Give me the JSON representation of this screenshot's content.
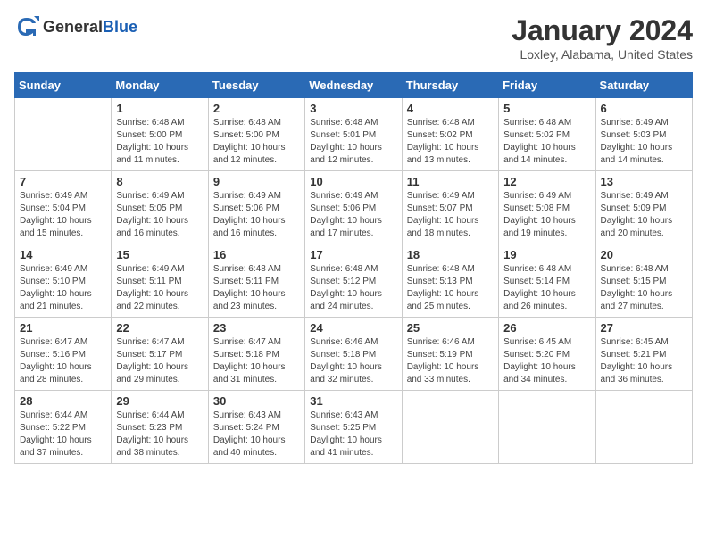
{
  "header": {
    "logo_general": "General",
    "logo_blue": "Blue",
    "month_year": "January 2024",
    "location": "Loxley, Alabama, United States"
  },
  "weekdays": [
    "Sunday",
    "Monday",
    "Tuesday",
    "Wednesday",
    "Thursday",
    "Friday",
    "Saturday"
  ],
  "weeks": [
    [
      {
        "day": "",
        "info": ""
      },
      {
        "day": "1",
        "info": "Sunrise: 6:48 AM\nSunset: 5:00 PM\nDaylight: 10 hours and 11 minutes."
      },
      {
        "day": "2",
        "info": "Sunrise: 6:48 AM\nSunset: 5:00 PM\nDaylight: 10 hours and 12 minutes."
      },
      {
        "day": "3",
        "info": "Sunrise: 6:48 AM\nSunset: 5:01 PM\nDaylight: 10 hours and 12 minutes."
      },
      {
        "day": "4",
        "info": "Sunrise: 6:48 AM\nSunset: 5:02 PM\nDaylight: 10 hours and 13 minutes."
      },
      {
        "day": "5",
        "info": "Sunrise: 6:48 AM\nSunset: 5:02 PM\nDaylight: 10 hours and 14 minutes."
      },
      {
        "day": "6",
        "info": "Sunrise: 6:49 AM\nSunset: 5:03 PM\nDaylight: 10 hours and 14 minutes."
      }
    ],
    [
      {
        "day": "7",
        "info": "Sunrise: 6:49 AM\nSunset: 5:04 PM\nDaylight: 10 hours and 15 minutes."
      },
      {
        "day": "8",
        "info": "Sunrise: 6:49 AM\nSunset: 5:05 PM\nDaylight: 10 hours and 16 minutes."
      },
      {
        "day": "9",
        "info": "Sunrise: 6:49 AM\nSunset: 5:06 PM\nDaylight: 10 hours and 16 minutes."
      },
      {
        "day": "10",
        "info": "Sunrise: 6:49 AM\nSunset: 5:06 PM\nDaylight: 10 hours and 17 minutes."
      },
      {
        "day": "11",
        "info": "Sunrise: 6:49 AM\nSunset: 5:07 PM\nDaylight: 10 hours and 18 minutes."
      },
      {
        "day": "12",
        "info": "Sunrise: 6:49 AM\nSunset: 5:08 PM\nDaylight: 10 hours and 19 minutes."
      },
      {
        "day": "13",
        "info": "Sunrise: 6:49 AM\nSunset: 5:09 PM\nDaylight: 10 hours and 20 minutes."
      }
    ],
    [
      {
        "day": "14",
        "info": "Sunrise: 6:49 AM\nSunset: 5:10 PM\nDaylight: 10 hours and 21 minutes."
      },
      {
        "day": "15",
        "info": "Sunrise: 6:49 AM\nSunset: 5:11 PM\nDaylight: 10 hours and 22 minutes."
      },
      {
        "day": "16",
        "info": "Sunrise: 6:48 AM\nSunset: 5:11 PM\nDaylight: 10 hours and 23 minutes."
      },
      {
        "day": "17",
        "info": "Sunrise: 6:48 AM\nSunset: 5:12 PM\nDaylight: 10 hours and 24 minutes."
      },
      {
        "day": "18",
        "info": "Sunrise: 6:48 AM\nSunset: 5:13 PM\nDaylight: 10 hours and 25 minutes."
      },
      {
        "day": "19",
        "info": "Sunrise: 6:48 AM\nSunset: 5:14 PM\nDaylight: 10 hours and 26 minutes."
      },
      {
        "day": "20",
        "info": "Sunrise: 6:48 AM\nSunset: 5:15 PM\nDaylight: 10 hours and 27 minutes."
      }
    ],
    [
      {
        "day": "21",
        "info": "Sunrise: 6:47 AM\nSunset: 5:16 PM\nDaylight: 10 hours and 28 minutes."
      },
      {
        "day": "22",
        "info": "Sunrise: 6:47 AM\nSunset: 5:17 PM\nDaylight: 10 hours and 29 minutes."
      },
      {
        "day": "23",
        "info": "Sunrise: 6:47 AM\nSunset: 5:18 PM\nDaylight: 10 hours and 31 minutes."
      },
      {
        "day": "24",
        "info": "Sunrise: 6:46 AM\nSunset: 5:18 PM\nDaylight: 10 hours and 32 minutes."
      },
      {
        "day": "25",
        "info": "Sunrise: 6:46 AM\nSunset: 5:19 PM\nDaylight: 10 hours and 33 minutes."
      },
      {
        "day": "26",
        "info": "Sunrise: 6:45 AM\nSunset: 5:20 PM\nDaylight: 10 hours and 34 minutes."
      },
      {
        "day": "27",
        "info": "Sunrise: 6:45 AM\nSunset: 5:21 PM\nDaylight: 10 hours and 36 minutes."
      }
    ],
    [
      {
        "day": "28",
        "info": "Sunrise: 6:44 AM\nSunset: 5:22 PM\nDaylight: 10 hours and 37 minutes."
      },
      {
        "day": "29",
        "info": "Sunrise: 6:44 AM\nSunset: 5:23 PM\nDaylight: 10 hours and 38 minutes."
      },
      {
        "day": "30",
        "info": "Sunrise: 6:43 AM\nSunset: 5:24 PM\nDaylight: 10 hours and 40 minutes."
      },
      {
        "day": "31",
        "info": "Sunrise: 6:43 AM\nSunset: 5:25 PM\nDaylight: 10 hours and 41 minutes."
      },
      {
        "day": "",
        "info": ""
      },
      {
        "day": "",
        "info": ""
      },
      {
        "day": "",
        "info": ""
      }
    ]
  ]
}
